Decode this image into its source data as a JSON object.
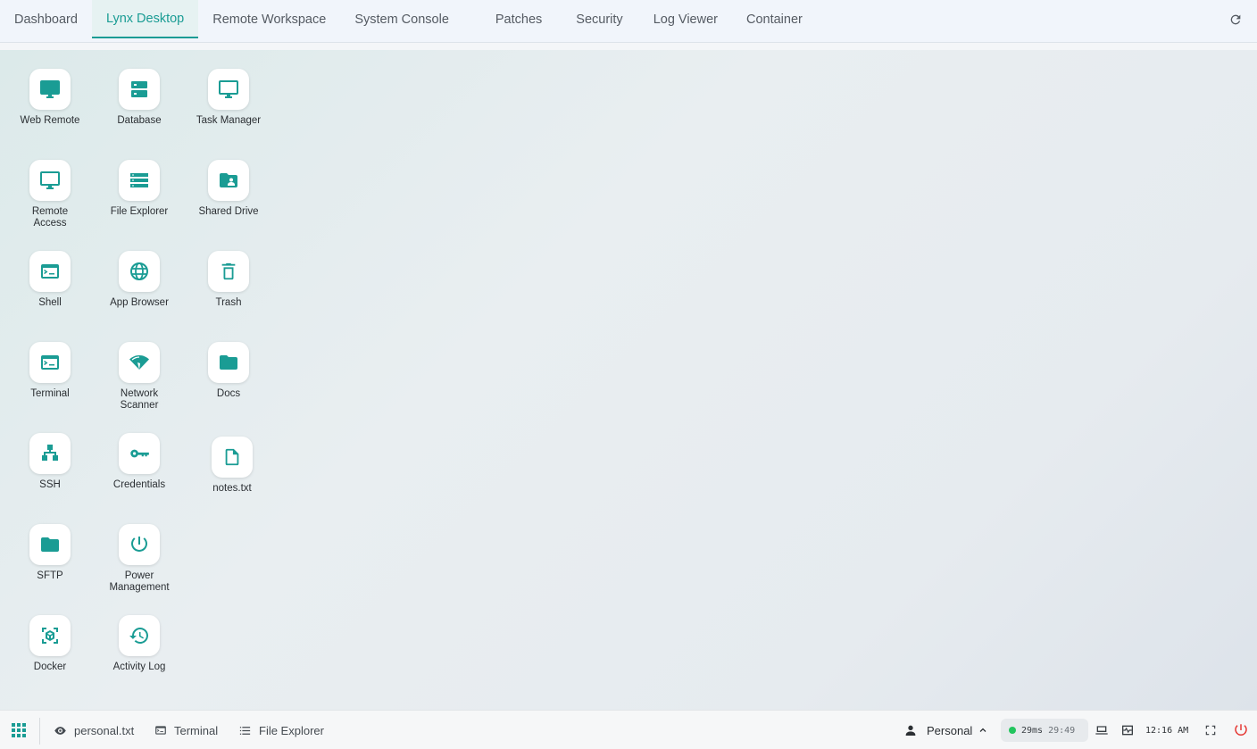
{
  "colors": {
    "accent": "#1a9c94",
    "status_ok": "#22c55e",
    "power": "#e53935"
  },
  "tabs": [
    {
      "label": "Dashboard"
    },
    {
      "label": "Lynx Desktop",
      "active": true
    },
    {
      "label": "Remote Workspace"
    },
    {
      "label": "System Console"
    },
    {
      "label": "Patches"
    },
    {
      "label": "Security"
    },
    {
      "label": "Log Viewer"
    },
    {
      "label": "Container"
    }
  ],
  "desktop": {
    "icons": [
      {
        "label": "Web Remote",
        "icon": "monitor-filled-icon"
      },
      {
        "label": "Database",
        "icon": "database-icon"
      },
      {
        "label": "Task Manager",
        "icon": "monitor-outline-icon"
      },
      {
        "label": "Remote Access",
        "icon": "monitor-outline-icon"
      },
      {
        "label": "File Explorer",
        "icon": "server-list-icon"
      },
      {
        "label": "Shared Drive",
        "icon": "shared-folder-icon"
      },
      {
        "label": "Shell",
        "icon": "terminal-icon"
      },
      {
        "label": "App Browser",
        "icon": "globe-icon"
      },
      {
        "label": "Trash",
        "icon": "trash-icon"
      },
      {
        "label": "Terminal",
        "icon": "terminal-icon"
      },
      {
        "label": "Network Scanner",
        "icon": "wifi-scan-icon"
      },
      {
        "label": "Docs",
        "icon": "folder-icon"
      },
      {
        "label": "SSH",
        "icon": "network-tree-icon"
      },
      {
        "label": "Credentials",
        "icon": "key-icon"
      },
      {
        "label": "notes.txt",
        "icon": "file-icon"
      },
      {
        "label": "SFTP",
        "icon": "folder-icon"
      },
      {
        "label": "Power Management",
        "icon": "power-icon"
      },
      {
        "label": "Docker",
        "icon": "container-box-icon"
      },
      {
        "label": "Activity Log",
        "icon": "history-icon"
      }
    ]
  },
  "taskbar": {
    "items": [
      {
        "label": "personal.txt",
        "icon": "eye-icon"
      },
      {
        "label": "Terminal",
        "icon": "terminal-icon"
      },
      {
        "label": "File Explorer",
        "icon": "list-icon"
      }
    ],
    "profile_label": "Personal",
    "latency": "29ms",
    "session_time": "29:49",
    "clock": "12:16 AM"
  }
}
